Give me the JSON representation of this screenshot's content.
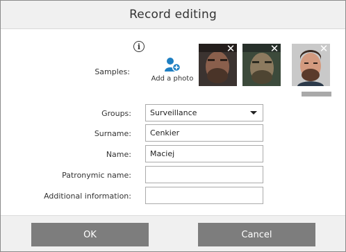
{
  "dialog": {
    "title": "Record editing"
  },
  "samples": {
    "label": "Samples:",
    "add_photo_label": "Add a photo",
    "close_glyph": "✕",
    "info_glyph": "i",
    "icons": {
      "info": "info-icon",
      "add_photo": "add-user-icon",
      "remove": "close-icon"
    }
  },
  "form": {
    "groups": {
      "label": "Groups:",
      "value": "Surveillance"
    },
    "surname": {
      "label": "Surname:",
      "value": "Cenkier"
    },
    "name": {
      "label": "Name:",
      "value": "Maciej"
    },
    "patronymic": {
      "label": "Patronymic name:",
      "value": ""
    },
    "additional": {
      "label": "Additional information:",
      "value": ""
    }
  },
  "buttons": {
    "ok": "OK",
    "cancel": "Cancel"
  },
  "colors": {
    "accent": "#1e7fc2",
    "button": "#7d7d7d",
    "header_bg": "#f0f0f0"
  }
}
